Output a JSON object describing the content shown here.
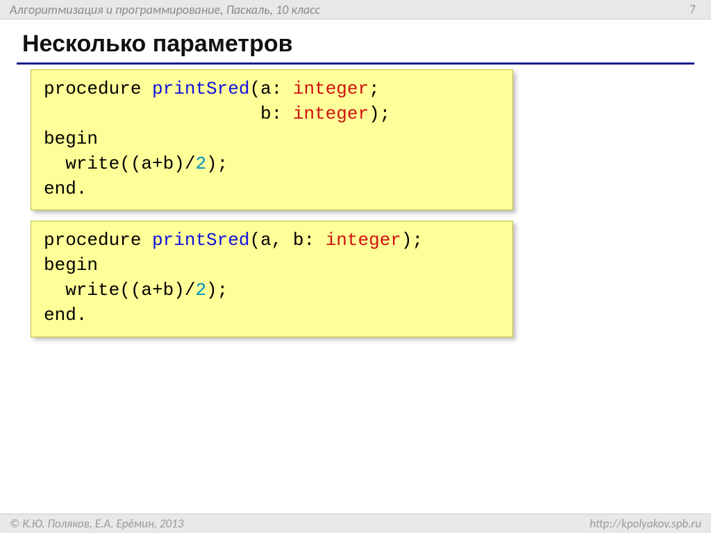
{
  "header": {
    "breadcrumb": "Алгоритмизация и программирование, Паскаль, 10 класс",
    "page_number": "7"
  },
  "title": "Несколько параметров",
  "code": {
    "block1": {
      "l1a": "procedure ",
      "l1b": "printSred",
      "l1c": "(a: ",
      "l1d": "integer",
      "l1e": ";",
      "l2a": "                    b: ",
      "l2b": "integer",
      "l2c": ");",
      "l3": "begin",
      "l4a": "  write((a+b)/",
      "l4b": "2",
      "l4c": ");",
      "l5": "end."
    },
    "block2": {
      "l1a": "procedure ",
      "l1b": "printSred",
      "l1c": "(a, b: ",
      "l1d": "integer",
      "l1e": ");",
      "l2": "begin",
      "l3a": "  write((a+b)/",
      "l3b": "2",
      "l3c": ");",
      "l4": "end."
    }
  },
  "footer": {
    "copyright": "К.Ю. Поляков, Е.А. Ерёмин, 2013",
    "url": "http://kpolyakov.spb.ru"
  }
}
